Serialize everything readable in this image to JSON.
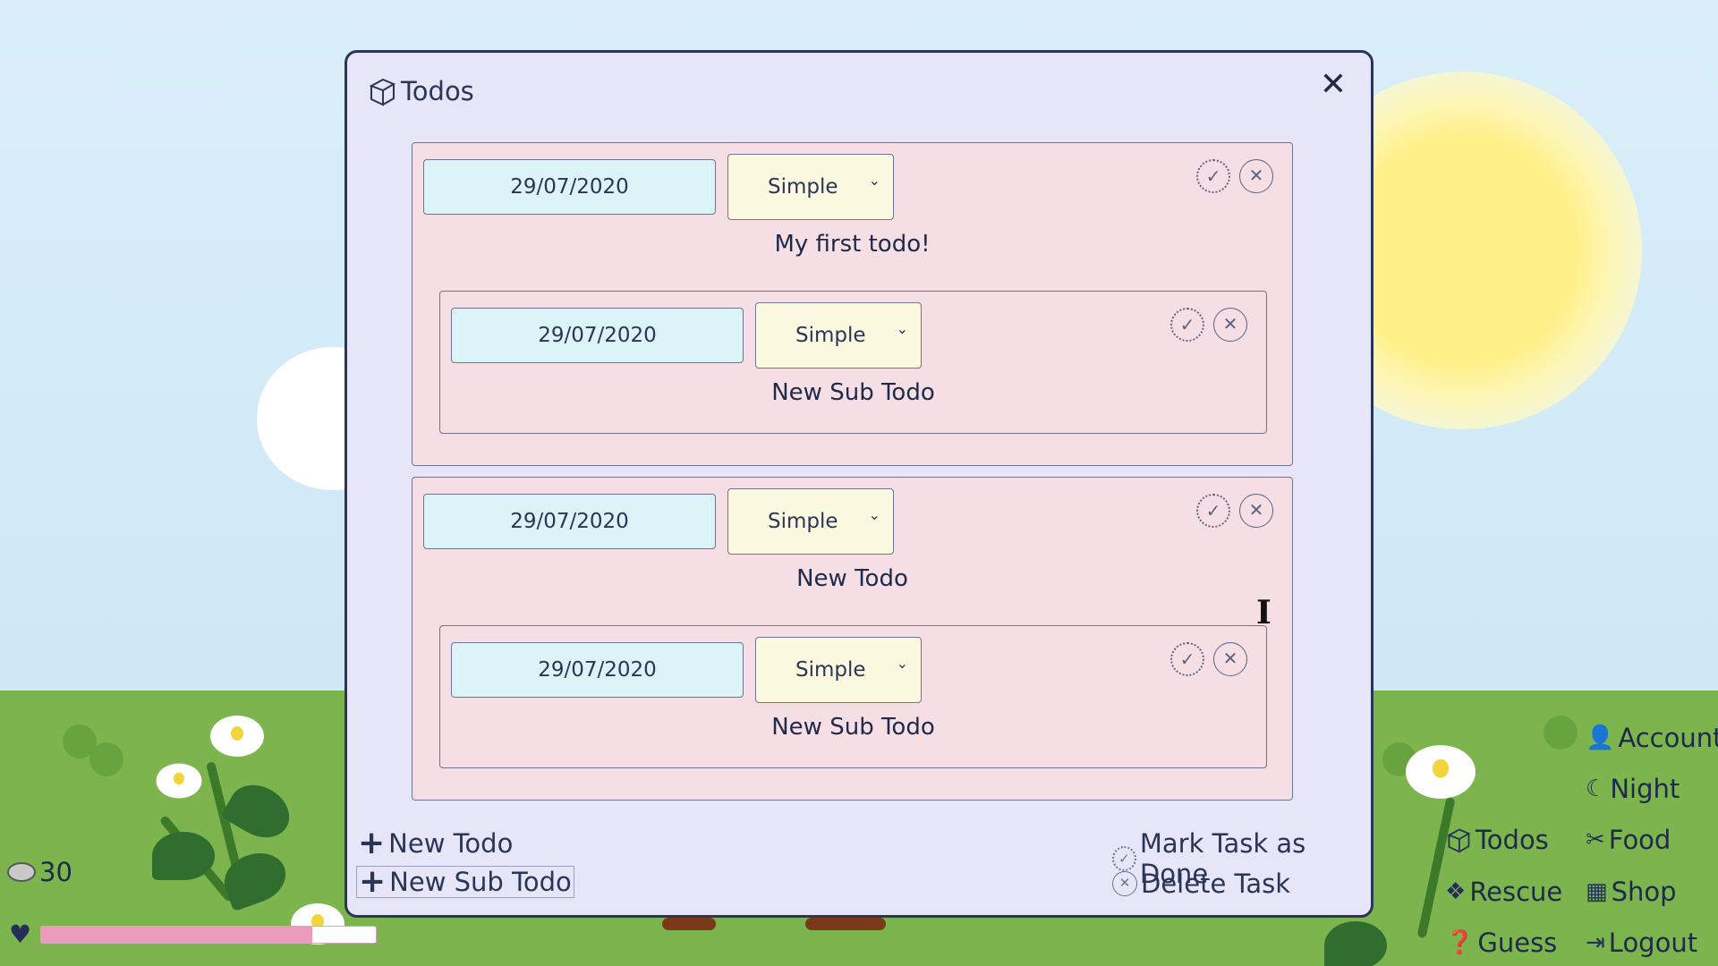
{
  "modal": {
    "title": "Todos",
    "title_icon": "book-icon",
    "close_icon": "close-icon",
    "close_label": "✕"
  },
  "todos": [
    {
      "date": "29/07/2020",
      "difficulty": "Simple",
      "text": "My first todo!",
      "subtodos": [
        {
          "date": "29/07/2020",
          "difficulty": "Simple",
          "text": "New Sub Todo"
        }
      ]
    },
    {
      "date": "29/07/2020",
      "difficulty": "Simple",
      "text": "New Todo",
      "subtodos": [
        {
          "date": "29/07/2020",
          "difficulty": "Simple",
          "text": "New Sub Todo"
        }
      ]
    }
  ],
  "bottom": {
    "new_todo": "New Todo",
    "new_sub_todo": "New Sub Todo",
    "mark_done": "Mark Task as Done",
    "delete_task": "Delete Task"
  },
  "hud": {
    "coins": "30",
    "health_fraction": 0.81,
    "health_color": "#ec9bbd"
  },
  "nav": {
    "account": "Account",
    "night": "Night",
    "todos": "Todos",
    "food": "Food",
    "rescue": "Rescue",
    "shop": "Shop",
    "guess": "Guess",
    "logout": "Logout"
  },
  "colors": {
    "modal_bg": "#e6e6f8",
    "todo_bg": "#f5dfe4",
    "date_bg": "#dcf4f8",
    "select_bg": "#fbf9df",
    "text": "#2a3558"
  }
}
